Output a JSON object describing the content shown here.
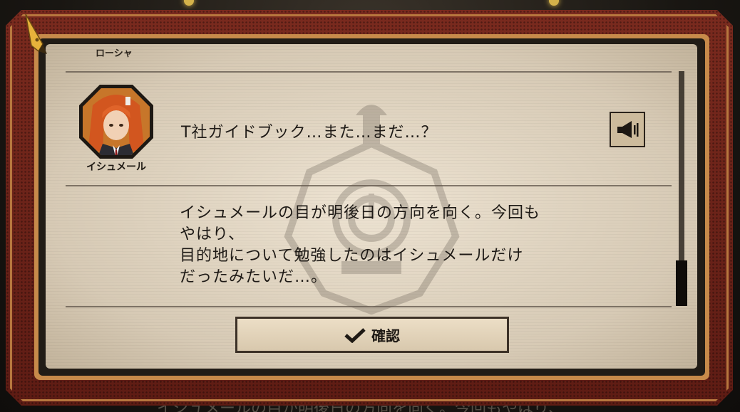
{
  "previous_speaker": "ローシャ",
  "entry": {
    "speaker_name": "イシュメール",
    "line": "T社ガイドブック…また…まだ…？",
    "voice_icon": "speaker-icon"
  },
  "narration_lines": [
    "イシュメールの目が明後日の方向を向く。今回も",
    "やはり、",
    "目的地について勉強したのはイシュメールだけ",
    "だったみたいだ…。"
  ],
  "confirm_button": {
    "icon": "checkmark-icon",
    "label": "確認"
  },
  "background_text": "イシュメールの目が明後日の方向を向く。今回もやはり、",
  "colors": {
    "frame_red": "#6e241a",
    "frame_gold": "#c78a4a",
    "paper": "#e6dbc8",
    "text": "#1e1a16"
  }
}
